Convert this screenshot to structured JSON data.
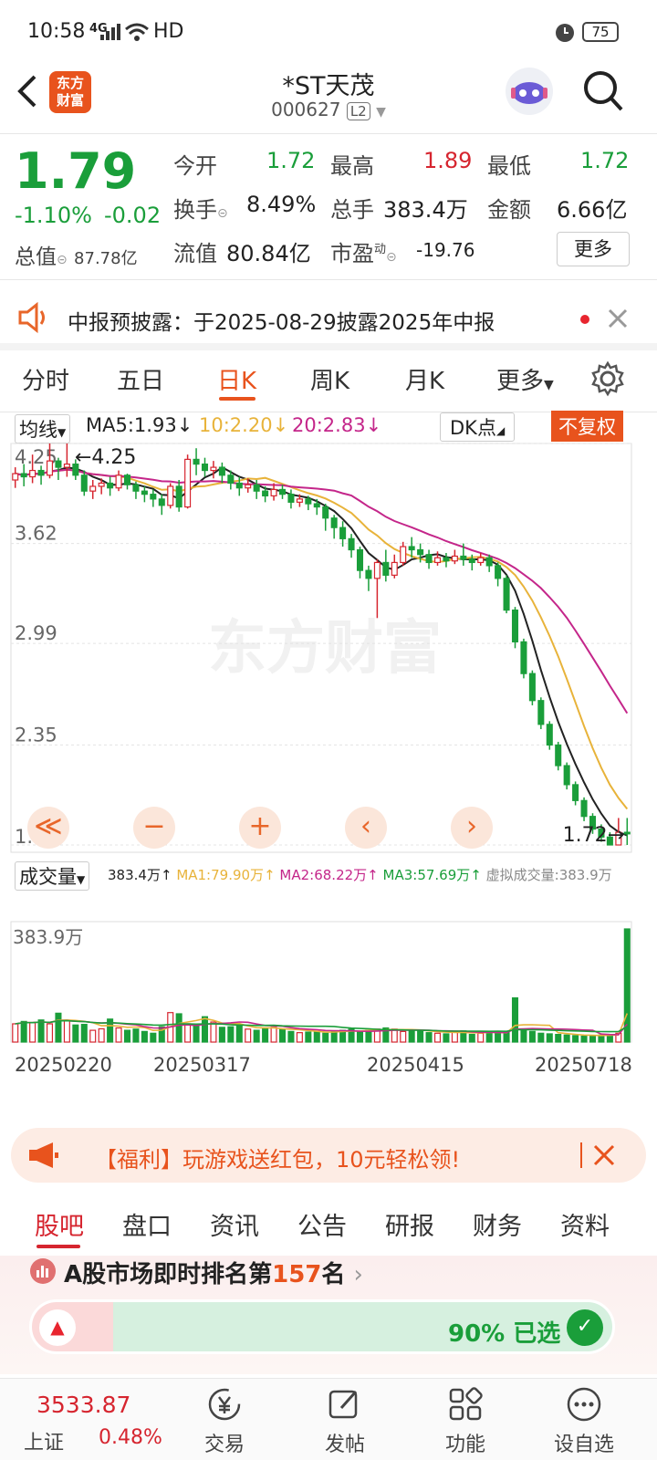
{
  "status_bar": {
    "time": "10:58",
    "network": "4G",
    "hd": "HD",
    "battery": "75"
  },
  "header": {
    "logo_text_1": "东方",
    "logo_text_2": "财富",
    "title": "*ST天茂",
    "code": "000627",
    "level_badge": "L2"
  },
  "quote": {
    "price": "1.79",
    "change_pct": "-1.10%",
    "change": "-0.02",
    "open_label": "今开",
    "open": "1.72",
    "high_label": "最高",
    "high": "1.89",
    "low_label": "最低",
    "low": "1.72",
    "turnover_label": "换手",
    "turnover": "8.49%",
    "volume_label": "总手",
    "volume": "383.4万",
    "amount_label": "金额",
    "amount": "6.66亿",
    "mcap_label": "总值",
    "mcap": "87.78亿",
    "float_label": "流值",
    "float_value": "80.84亿",
    "pe_label": "市盈",
    "pe_sup": "动",
    "pe": "-19.76",
    "more_button": "更多"
  },
  "notice": {
    "text": "中报预披露：于2025-08-29披露2025年中报"
  },
  "tabs": [
    {
      "label": "分时"
    },
    {
      "label": "五日"
    },
    {
      "label": "日K"
    },
    {
      "label": "周K"
    },
    {
      "label": "月K"
    },
    {
      "label": "更多"
    }
  ],
  "kline": {
    "ma_selector": "均线",
    "ma5": "MA5:1.93",
    "ma10": "10:2.20",
    "ma20": "20:2.83",
    "dk_button": "DK点",
    "adjust_button": "不复权",
    "max_marker": "4.25",
    "min_marker": "1.72",
    "watermark": "东方财富",
    "y_ticks": [
      "4.25",
      "3.62",
      "2.99",
      "2.35",
      "1.72"
    ]
  },
  "volume": {
    "selector": "成交量",
    "vol": "383.4万",
    "ma1": "MA1:79.90万",
    "ma2": "MA2:68.22万",
    "ma3": "MA3:57.69万",
    "virtual": "虚拟成交量:383.9万",
    "max_label": "383.9万",
    "dates": [
      "20250220",
      "20250317",
      "20250415",
      "20250718"
    ]
  },
  "chart_data": {
    "type": "candlestick",
    "y_range": [
      1.72,
      4.25
    ],
    "y_ticks": [
      4.25,
      3.62,
      2.99,
      2.35,
      1.72
    ],
    "x_ticks": [
      "20250220",
      "20250317",
      "20250415",
      "20250718"
    ],
    "series": [
      {
        "name": "MA5",
        "value": 1.93,
        "color": "#222222"
      },
      {
        "name": "MA10",
        "value": 2.2,
        "color": "#e8b33a"
      },
      {
        "name": "MA20",
        "value": 2.83,
        "color": "#c4268a"
      }
    ],
    "candles": [
      [
        4.02,
        4.06,
        3.97,
        4.1
      ],
      [
        4.06,
        4.04,
        3.98,
        4.12
      ],
      [
        4.04,
        4.08,
        4.0,
        4.18
      ],
      [
        4.08,
        4.05,
        3.99,
        4.11
      ],
      [
        4.05,
        4.14,
        4.03,
        4.25
      ],
      [
        4.14,
        4.1,
        4.02,
        4.16
      ],
      [
        4.1,
        4.12,
        4.04,
        4.25
      ],
      [
        4.12,
        4.05,
        4.02,
        4.15
      ],
      [
        4.05,
        3.95,
        3.92,
        4.08
      ],
      [
        3.95,
        3.98,
        3.9,
        4.02
      ],
      [
        3.98,
        4.0,
        3.93,
        4.03
      ],
      [
        4.0,
        3.97,
        3.92,
        4.04
      ],
      [
        3.97,
        4.05,
        3.95,
        4.08
      ],
      [
        4.05,
        3.99,
        3.96,
        4.06
      ],
      [
        3.99,
        3.95,
        3.9,
        4.01
      ],
      [
        3.95,
        3.93,
        3.88,
        3.98
      ],
      [
        3.93,
        3.9,
        3.85,
        3.96
      ],
      [
        3.9,
        3.86,
        3.8,
        3.93
      ],
      [
        3.86,
        3.98,
        3.84,
        4.0
      ],
      [
        3.98,
        3.85,
        3.82,
        4.02
      ],
      [
        3.85,
        4.15,
        3.84,
        4.18
      ],
      [
        4.15,
        4.12,
        4.05,
        4.22
      ],
      [
        4.12,
        4.08,
        4.04,
        4.16
      ],
      [
        4.08,
        4.1,
        4.03,
        4.14
      ],
      [
        4.1,
        4.05,
        4.0,
        4.13
      ],
      [
        4.05,
        4.0,
        3.96,
        4.08
      ],
      [
        4.0,
        3.97,
        3.92,
        4.04
      ],
      [
        3.97,
        3.99,
        3.94,
        4.03
      ],
      [
        3.99,
        3.95,
        3.9,
        4.02
      ],
      [
        3.95,
        3.92,
        3.88,
        3.98
      ],
      [
        3.92,
        3.96,
        3.89,
        4.0
      ],
      [
        3.96,
        3.93,
        3.9,
        3.99
      ],
      [
        3.93,
        3.88,
        3.84,
        3.96
      ],
      [
        3.88,
        3.9,
        3.85,
        3.93
      ],
      [
        3.9,
        3.87,
        3.83,
        3.92
      ],
      [
        3.87,
        3.85,
        3.8,
        3.9
      ],
      [
        3.85,
        3.78,
        3.7,
        3.87
      ],
      [
        3.78,
        3.72,
        3.65,
        3.8
      ],
      [
        3.72,
        3.65,
        3.6,
        3.76
      ],
      [
        3.65,
        3.58,
        3.53,
        3.68
      ],
      [
        3.58,
        3.45,
        3.4,
        3.6
      ],
      [
        3.45,
        3.4,
        3.32,
        3.48
      ],
      [
        3.4,
        3.5,
        3.15,
        3.52
      ],
      [
        3.5,
        3.42,
        3.38,
        3.58
      ],
      [
        3.42,
        3.5,
        3.4,
        3.55
      ],
      [
        3.5,
        3.6,
        3.48,
        3.63
      ],
      [
        3.6,
        3.58,
        3.53,
        3.66
      ],
      [
        3.58,
        3.55,
        3.5,
        3.62
      ],
      [
        3.55,
        3.5,
        3.46,
        3.58
      ],
      [
        3.5,
        3.53,
        3.48,
        3.57
      ],
      [
        3.53,
        3.51,
        3.47,
        3.56
      ],
      [
        3.51,
        3.54,
        3.49,
        3.58
      ],
      [
        3.54,
        3.52,
        3.48,
        3.62
      ],
      [
        3.52,
        3.5,
        3.45,
        3.55
      ],
      [
        3.5,
        3.53,
        3.48,
        3.56
      ],
      [
        3.53,
        3.48,
        3.44,
        3.55
      ],
      [
        3.48,
        3.4,
        3.35,
        3.5
      ],
      [
        3.4,
        3.2,
        3.18,
        3.42
      ],
      [
        3.2,
        3.0,
        2.96,
        3.22
      ],
      [
        3.0,
        2.8,
        2.77,
        3.02
      ],
      [
        2.8,
        2.63,
        2.6,
        2.82
      ],
      [
        2.63,
        2.48,
        2.45,
        2.65
      ],
      [
        2.48,
        2.35,
        2.32,
        2.5
      ],
      [
        2.35,
        2.22,
        2.19,
        2.37
      ],
      [
        2.22,
        2.1,
        2.07,
        2.24
      ],
      [
        2.1,
        2.0,
        1.97,
        2.12
      ],
      [
        2.0,
        1.9,
        1.87,
        2.02
      ],
      [
        1.9,
        1.82,
        1.79,
        1.92
      ],
      [
        1.82,
        1.77,
        1.74,
        1.85
      ],
      [
        1.77,
        1.72,
        1.72,
        1.8
      ],
      [
        1.72,
        1.8,
        1.72,
        1.89
      ],
      [
        1.8,
        1.79,
        1.72,
        1.89
      ]
    ],
    "volumes": [
      62,
      70,
      66,
      75,
      62,
      98,
      74,
      58,
      60,
      40,
      45,
      78,
      48,
      40,
      44,
      36,
      30,
      52,
      100,
      96,
      62,
      56,
      86,
      68,
      50,
      52,
      58,
      44,
      40,
      48,
      50,
      44,
      36,
      32,
      34,
      36,
      30,
      38,
      40,
      44,
      36,
      40,
      44,
      48,
      44,
      36,
      40,
      38,
      32,
      30,
      28,
      36,
      38,
      26,
      30,
      34,
      36,
      32,
      150,
      40,
      36,
      30,
      28,
      26,
      24,
      22,
      20,
      22,
      24,
      26,
      30,
      384
    ],
    "vol_ma": [
      {
        "name": "MA1",
        "value": "79.90万",
        "color": "#e8b33a"
      },
      {
        "name": "MA2",
        "value": "68.22万",
        "color": "#c4268a"
      },
      {
        "name": "MA3",
        "value": "57.69万",
        "color": "#1a9e3a"
      }
    ]
  },
  "controls": {
    "rewind": "≪",
    "zoom_out": "−",
    "zoom_in": "+",
    "prev": "‹",
    "next": "›"
  },
  "promo": {
    "text": "【福利】玩游戏送红包，10元轻松领!"
  },
  "subtabs": [
    {
      "label": "股吧"
    },
    {
      "label": "盘口"
    },
    {
      "label": "资讯"
    },
    {
      "label": "公告"
    },
    {
      "label": "研报"
    },
    {
      "label": "财务"
    },
    {
      "label": "资料"
    }
  ],
  "rank": {
    "prefix": "A股市场即时排名第",
    "number": "157",
    "suffix": "名",
    "selected_pct": "90% 已选"
  },
  "bottom_nav": {
    "index_value": "3533.87",
    "index_name": "上证",
    "index_change": "0.48%",
    "trade": "交易",
    "post": "发帖",
    "features": "功能",
    "watchlist": "设自选"
  },
  "colors": {
    "accent": "#e8531d",
    "up": "#d6252f",
    "down": "#1a9e3a"
  }
}
